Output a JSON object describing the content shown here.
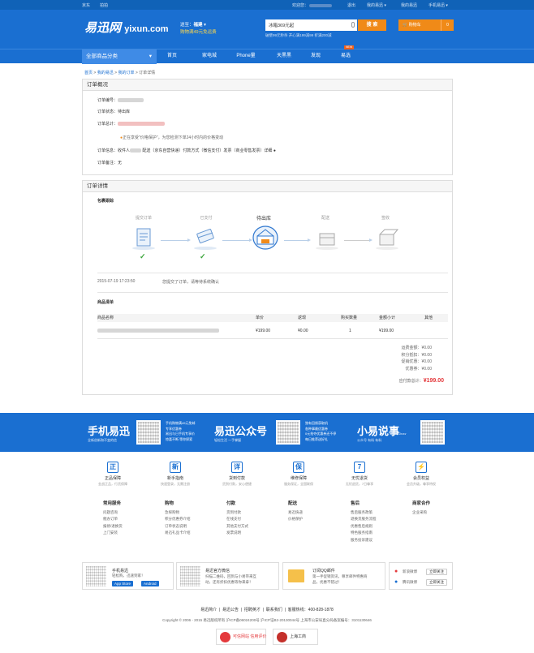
{
  "topbar": {
    "links": [
      "京东",
      "拍拍"
    ],
    "welcome": "欢迎您",
    "logout": "退出",
    "my_yixun": "我的易迅",
    "mobile": "手机易迅"
  },
  "header": {
    "logo_cn": "易迅网",
    "logo_en": "yixun.com",
    "location_label": "送至",
    "location_value": "福建",
    "promo": "购物满49元免运费",
    "search_value": "冰箱369元起",
    "search_button": "搜 索",
    "hot_words": "破壁99元秒杀   开心满199减99   折满200减",
    "cart_label": "购物车",
    "cart_count": "0"
  },
  "nav": {
    "all_categories": "全部商品分类",
    "items": [
      "首页",
      "家电城",
      "Phone量",
      "天黑黑",
      "发现",
      "易选"
    ],
    "new_tag": "NEW"
  },
  "breadcrumb": {
    "home": "首页",
    "my": "我的易迅",
    "orders": "我的订单",
    "current": "订单详情"
  },
  "overview": {
    "title": "订单概况",
    "order_no_label": "订单编号：",
    "status_label": "订单状态：",
    "status_value": "待出库",
    "total_label": "订单总计：",
    "price_protect": "正在享受\"价格保护\"，为您检测下单24小时内的价格变动",
    "info_label": "订单信息：",
    "info_text": "配送（京东自营快递）付款方式（微信支付）发票（商业零售发票）详细",
    "info_prefix": "收件人",
    "note_label": "订单备注：",
    "note_value": "无"
  },
  "details": {
    "title": "订单详情",
    "tracking_title": "包裹跟踪",
    "steps": [
      "提交订单",
      "已支付",
      "待出库",
      "配送",
      "签收"
    ],
    "log_time": "2015-07-19 17:23:50",
    "log_text": "您提交了订单，请等待系统确认",
    "goods_title": "商品清单",
    "table_headers": [
      "商品名称",
      "单价",
      "返现",
      "购买数量",
      "金额小计",
      "其他"
    ],
    "rows": [
      {
        "price": "¥199.00",
        "cashback": "¥0.00",
        "qty": "1",
        "subtotal": "¥199.00"
      }
    ],
    "summary": [
      {
        "label": "运费金额：",
        "value": "¥0.00"
      },
      {
        "label": "积分抵扣：",
        "value": "¥0.00"
      },
      {
        "label": "促销优惠：",
        "value": "¥0.00"
      },
      {
        "label": "优惠券：",
        "value": "¥0.00"
      }
    ],
    "total_label": "应付款总计：",
    "total_value": "¥199.00"
  },
  "banner": {
    "items": [
      {
        "title": "手机易迅",
        "sub": "全新创新和不变的信",
        "desc1": "手机购物满49元免邮",
        "desc2": "专享优惠券",
        "desc3": "易迅与日手机专享价",
        "desc4": "惊喜不断 等你探索"
      },
      {
        "title": "易迅公众号",
        "sub": "轻松生活 一手掌握",
        "desc1": "独有回馈获取机",
        "desc2": "各种事最优惠券",
        "desc3": "0元抢夺优惠券还不停",
        "desc4": "每日推荐送好礼"
      },
      {
        "title": "小易说事",
        "sub": "公众号 有料 有料",
        "en": "Talk Show"
      }
    ]
  },
  "services": [
    {
      "icon": "正",
      "title": "正品保障",
      "desc": "金战正品，行货保障"
    },
    {
      "icon": "新",
      "title": "新手指南",
      "desc": "快速登录，无需注册"
    },
    {
      "icon": "详",
      "title": "货到付款",
      "desc": "货到付款，安心便捷"
    },
    {
      "icon": "保",
      "title": "维修保障",
      "desc": "服务保证，全国联保"
    },
    {
      "icon": "7",
      "title": "无忧退货",
      "desc": "无忧退货，7日尊享"
    },
    {
      "icon": "⚡",
      "title": "会员权益",
      "desc": "会员升级，尊享特权"
    }
  ],
  "footer_cols": [
    {
      "head": "常用服务",
      "links": [
        "问题咨询",
        "催办订单",
        "报修/退换货",
        "上门安装"
      ]
    },
    {
      "head": "购物",
      "links": [
        "急探购物",
        "积分优惠券介绍",
        "订单状态说明",
        "易迅礼品卡介绍"
      ]
    },
    {
      "head": "付款",
      "links": [
        "货到付款",
        "在线支付",
        "其他支付方式",
        "发票说明"
      ]
    },
    {
      "head": "配送",
      "links": [
        "易迅快递",
        "价格保护"
      ]
    },
    {
      "head": "售后",
      "links": [
        "售后服务政策",
        "退换货服务流程",
        "优惠售后规则",
        "特色服务指南",
        "服务投诉建议"
      ]
    },
    {
      "head": "商家合作",
      "links": [
        "企业采购"
      ]
    }
  ],
  "apps": {
    "mobile_title": "手机易迅",
    "mobile_desc": "轻松购，迅速到家！",
    "app_store": "App Store",
    "android": "Android",
    "wechat_title": "易迅官方微信",
    "wechat_desc1": "扫描二维码，回到与小易带来互",
    "wechat_desc2": "动，还有折扣优惠等你来拿！",
    "qq_title": "订阅QQ邮件",
    "qq_desc1": "第一手促销资讯，尊享邮件特惠商",
    "qq_desc2": "品，优惠不错过！",
    "weibo": "新浪微博",
    "tencent": "腾讯微博",
    "follow": "立即关注"
  },
  "footer_links": [
    "易迅简介",
    "易迅公告",
    "招聘英才",
    "联系我们",
    "客服热线：400-828-1878"
  ],
  "copyright": "Copyright © 2006 - 2015 易迅版权所有   沪ICP备06024200号   沪ICP证B2-20130044号   上海市公安局直分局备案编号：3101130646",
  "badges": [
    "可信网站 信用评价",
    "上海工商"
  ]
}
